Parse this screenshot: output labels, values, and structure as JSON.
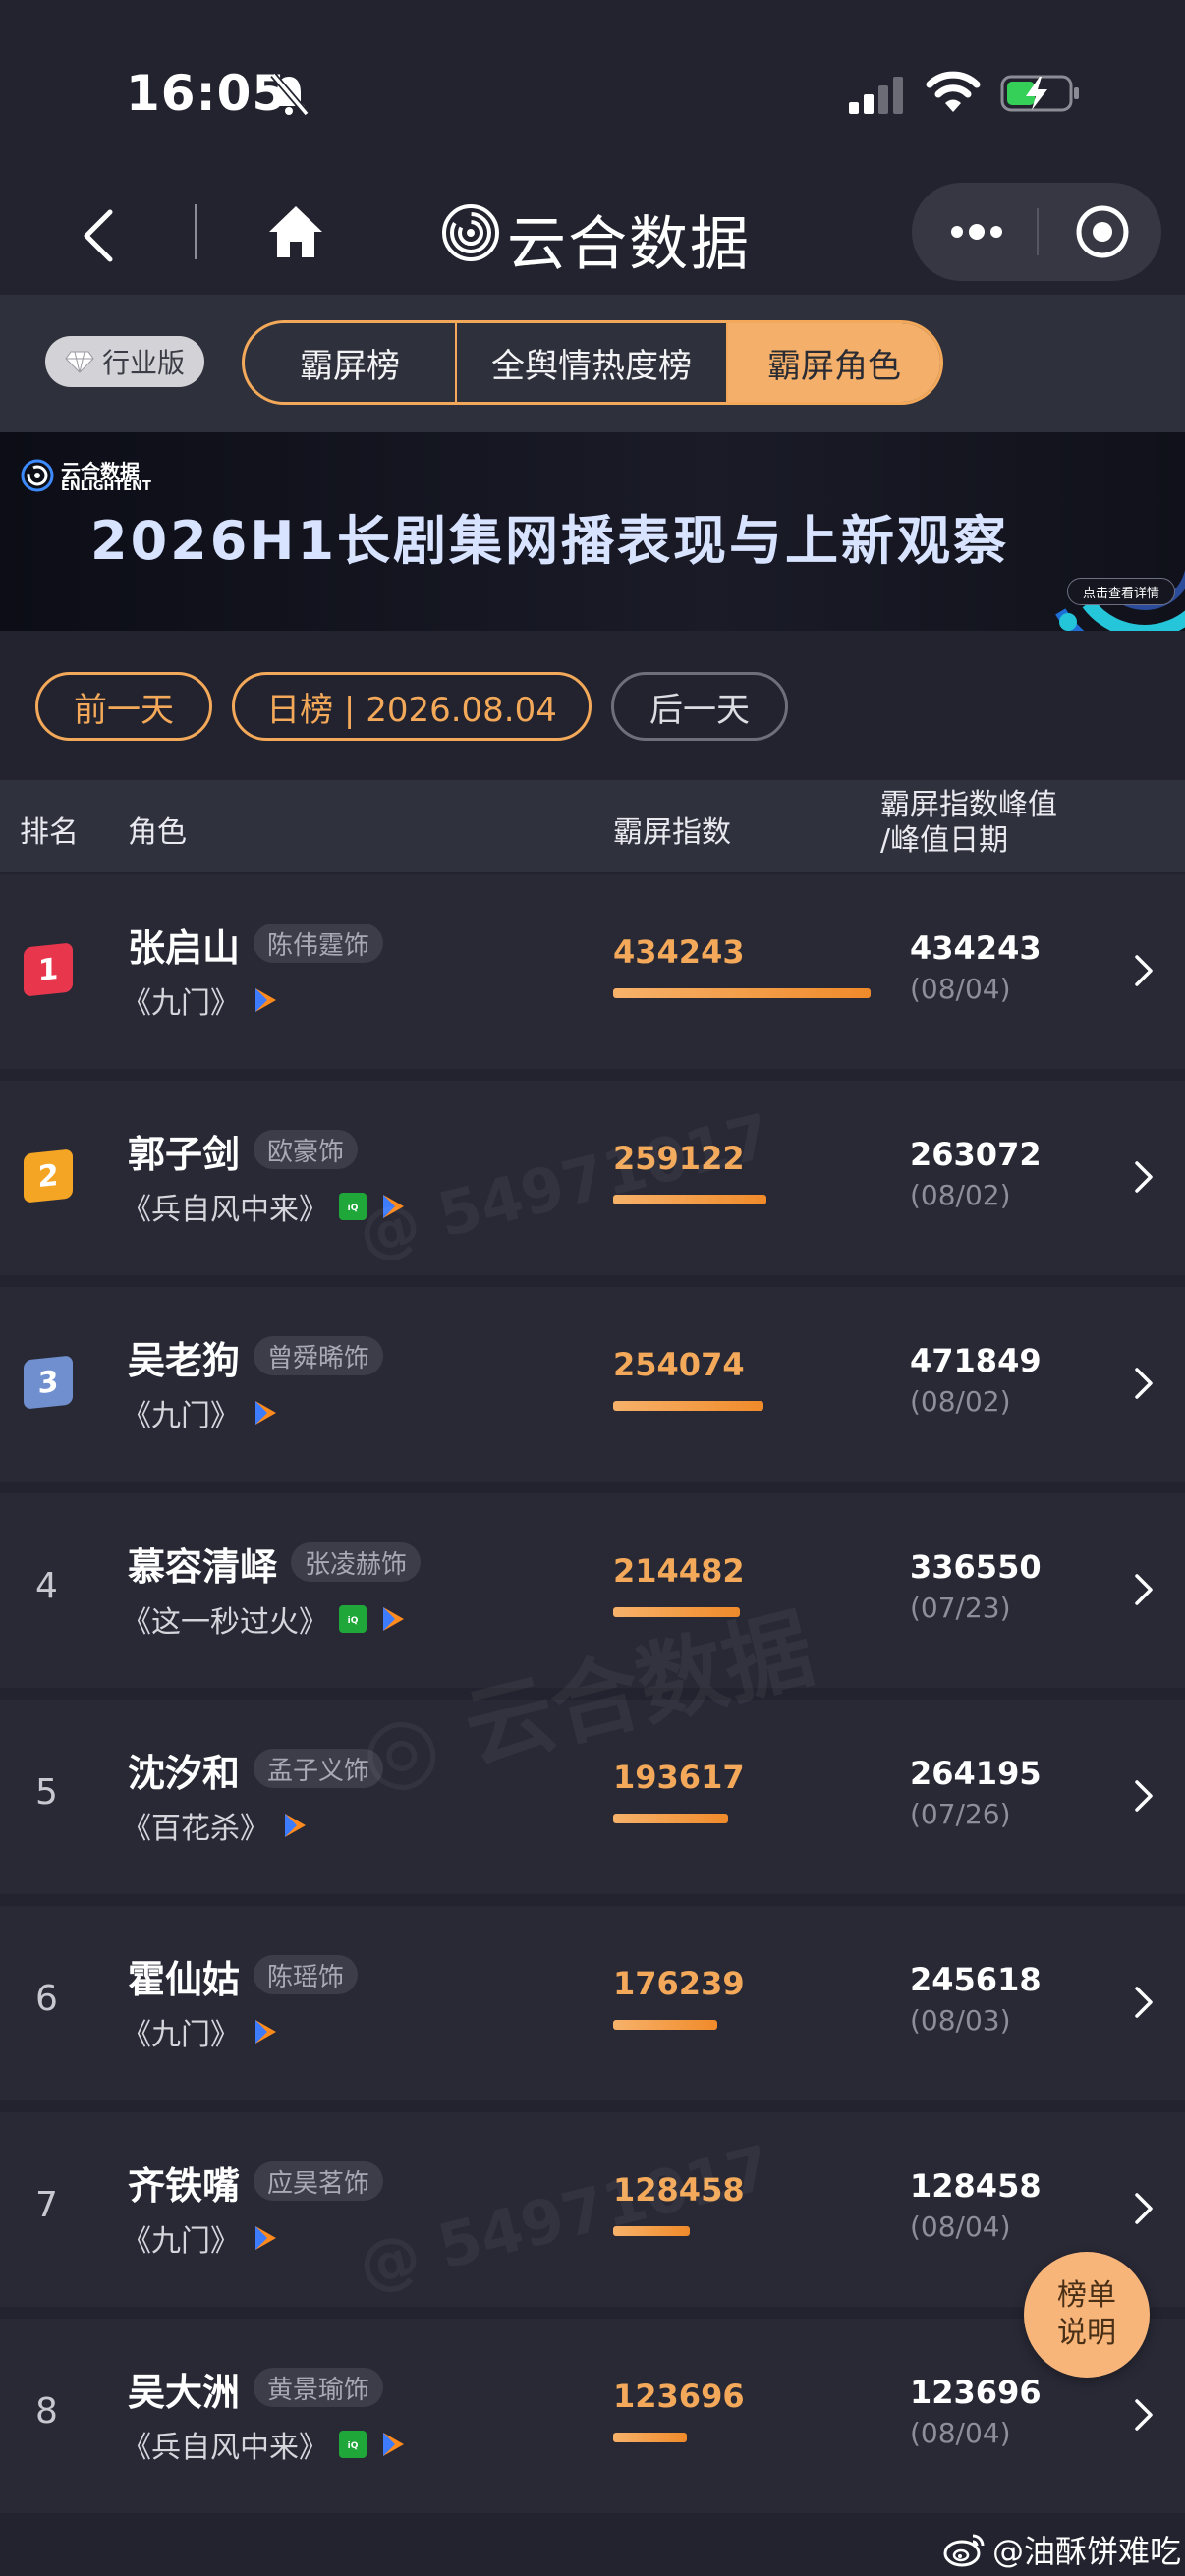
{
  "status_bar": {
    "time": "16:05"
  },
  "nav": {
    "title": "云合数据"
  },
  "tabs": {
    "badge": "行业版",
    "items": [
      {
        "label": "霸屏榜",
        "active": false
      },
      {
        "label": "全舆情热度榜",
        "active": false
      },
      {
        "label": "霸屏角色",
        "active": true
      }
    ]
  },
  "banner": {
    "logo_cn": "云合数据",
    "logo_en": "ENLIGHTENT",
    "title": "2026H1长剧集网播表现与上新观察",
    "detail_label": "点击查看详情"
  },
  "date_row": {
    "prev_label": "前一天",
    "current_label": "日榜 | 2026.08.04",
    "next_label": "后一天"
  },
  "table": {
    "headers": {
      "rank": "排名",
      "role": "角色",
      "index": "霸屏指数",
      "peak_line1": "霸屏指数峰值",
      "peak_line2": "/峰值日期"
    },
    "max_index": 434243,
    "rows": [
      {
        "rank": "1",
        "role": "张启山",
        "actor": "陈伟霆饰",
        "drama": "《九门》",
        "platforms": [
          "tencent"
        ],
        "index": "434243",
        "peak": "434243",
        "peak_date": "(08/04)"
      },
      {
        "rank": "2",
        "role": "郭子剑",
        "actor": "欧豪饰",
        "drama": "《兵自风中来》",
        "platforms": [
          "iqiyi",
          "tencent"
        ],
        "index": "259122",
        "peak": "263072",
        "peak_date": "(08/02)"
      },
      {
        "rank": "3",
        "role": "吴老狗",
        "actor": "曾舜晞饰",
        "drama": "《九门》",
        "platforms": [
          "tencent"
        ],
        "index": "254074",
        "peak": "471849",
        "peak_date": "(08/02)"
      },
      {
        "rank": "4",
        "role": "慕容清峄",
        "actor": "张凌赫饰",
        "drama": "《这一秒过火》",
        "platforms": [
          "iqiyi",
          "tencent"
        ],
        "index": "214482",
        "peak": "336550",
        "peak_date": "(07/23)"
      },
      {
        "rank": "5",
        "role": "沈汐和",
        "actor": "孟子义饰",
        "drama": "《百花杀》",
        "platforms": [
          "tencent"
        ],
        "index": "193617",
        "peak": "264195",
        "peak_date": "(07/26)"
      },
      {
        "rank": "6",
        "role": "霍仙姑",
        "actor": "陈瑶饰",
        "drama": "《九门》",
        "platforms": [
          "tencent"
        ],
        "index": "176239",
        "peak": "245618",
        "peak_date": "(08/03)"
      },
      {
        "rank": "7",
        "role": "齐铁嘴",
        "actor": "应昊茗饰",
        "drama": "《九门》",
        "platforms": [
          "tencent"
        ],
        "index": "128458",
        "peak": "128458",
        "peak_date": "(08/04)"
      },
      {
        "rank": "8",
        "role": "吴大洲",
        "actor": "黄景瑜饰",
        "drama": "《兵自风中来》",
        "platforms": [
          "iqiyi",
          "tencent"
        ],
        "index": "123696",
        "peak": "123696",
        "peak_date": "(08/04)"
      }
    ]
  },
  "float_button": {
    "line1": "榜单",
    "line2": "说明"
  },
  "footer": {
    "credit": "@油酥饼难吃"
  },
  "colors": {
    "accent": "#f3a959",
    "background": "#22232e",
    "row_bg": "#282935",
    "rank1": "#e8374c",
    "rank2": "#f5a524",
    "rank3": "#6f8fce"
  }
}
